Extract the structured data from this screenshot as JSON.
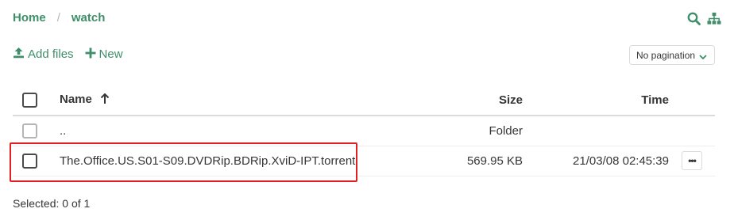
{
  "breadcrumb": {
    "home": "Home",
    "separator": "/",
    "current": "watch"
  },
  "icons": {
    "search": "search-icon",
    "sitemap": "sitemap-icon",
    "upload": "upload-icon",
    "plus": "plus-icon"
  },
  "actions": {
    "add_files": "Add files",
    "new": "New"
  },
  "pagination": {
    "selected": "No pagination"
  },
  "table": {
    "headers": {
      "name": "Name",
      "size": "Size",
      "time": "Time"
    },
    "rows": [
      {
        "name": "..",
        "size": "Folder",
        "time": ""
      },
      {
        "name": "The.Office.US.S01-S09.DVDRip.BDRip.XviD-IPT.torrent",
        "size": "569.95 KB",
        "time": "21/03/08 02:45:39",
        "more": "•••"
      }
    ]
  },
  "status": {
    "selected": "Selected: 0 of 1"
  },
  "colors": {
    "accent": "#3e8e69",
    "highlight": "#e02020"
  }
}
